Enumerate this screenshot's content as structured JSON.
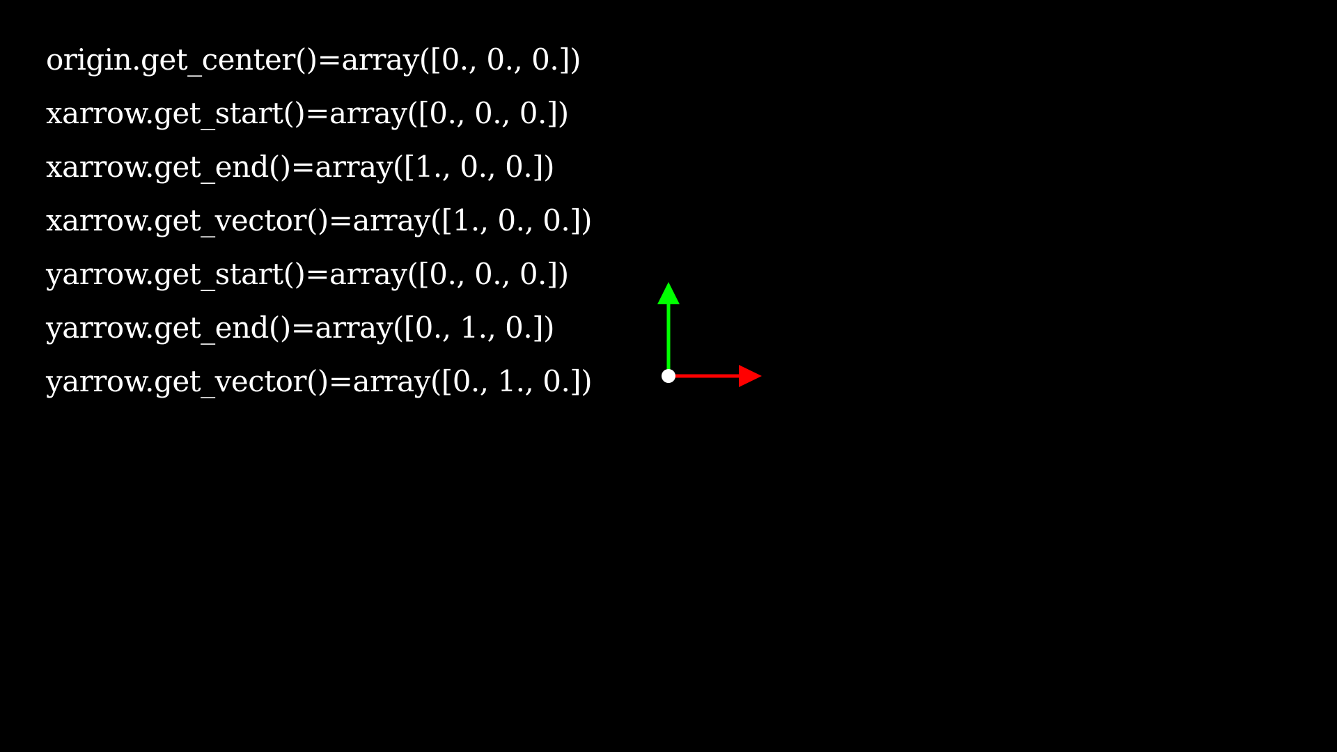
{
  "lines": [
    "origin.get_center()=array([0., 0., 0.])",
    "xarrow.get_start()=array([0., 0., 0.])",
    "xarrow.get_end()=array([1., 0., 0.])",
    "xarrow.get_vector()=array([1., 0., 0.])",
    "yarrow.get_start()=array([0., 0., 0.])",
    "yarrow.get_end()=array([0., 1., 0.])",
    "yarrow.get_vector()=array([0., 1., 0.])"
  ],
  "colors": {
    "background": "#000000",
    "text": "#ffffff",
    "origin_dot": "#ffffff",
    "x_arrow": "#ff0000",
    "y_arrow": "#00ff00"
  },
  "icons": {
    "origin": "origin-dot-icon",
    "x_arrow": "x-arrow-icon",
    "y_arrow": "y-arrow-icon"
  }
}
